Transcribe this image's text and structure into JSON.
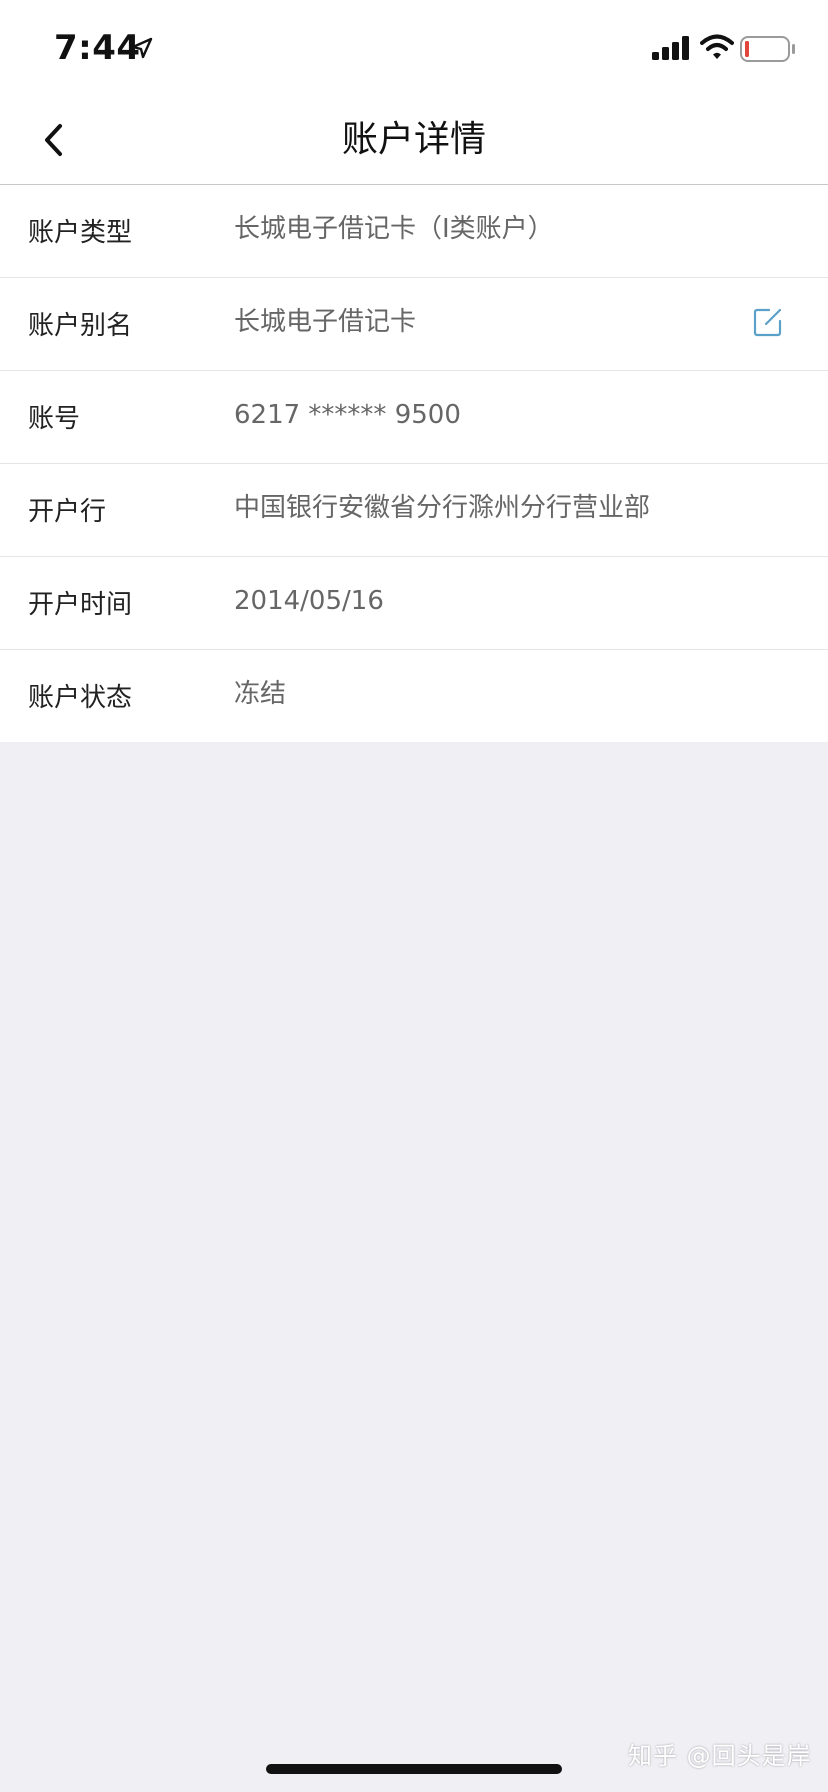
{
  "status_bar": {
    "time": "7:44",
    "location_icon": "location-arrow-icon",
    "signal_icon": "cellular-signal-icon",
    "wifi_icon": "wifi-icon",
    "battery_icon": "battery-low-icon"
  },
  "nav": {
    "back_icon": "chevron-left-icon",
    "title": "账户详情"
  },
  "details": [
    {
      "label": "账户类型",
      "value": "长城电子借记卡（I类账户）"
    },
    {
      "label": "账户别名",
      "value": "长城电子借记卡",
      "edit_icon": "edit-icon"
    },
    {
      "label": "账号",
      "value": "6217 ****** 9500"
    },
    {
      "label": "开户行",
      "value": "中国银行安徽省分行滁州分行营业部"
    },
    {
      "label": "开户时间",
      "value": "2014/05/16"
    },
    {
      "label": "账户状态",
      "value": "冻结"
    }
  ],
  "watermark": "知乎 @回头是岸",
  "colors": {
    "background": "#efeff4",
    "card": "#ffffff",
    "label_text": "#222222",
    "value_text": "#666666",
    "edit_icon": "#5aa0c8",
    "battery_low": "#e0463b"
  }
}
